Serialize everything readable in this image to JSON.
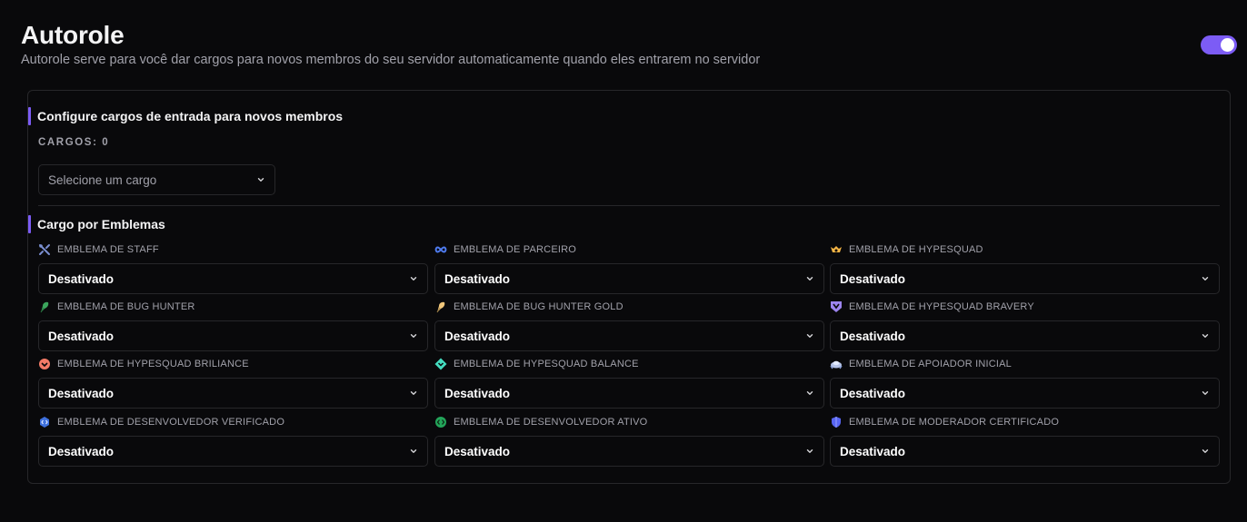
{
  "header": {
    "title": "Autorole",
    "subtitle": "Autorole serve para você dar cargos para novos membros do seu servidor automaticamente quando eles entrarem no servidor",
    "enabled": true
  },
  "entry_roles": {
    "title": "Configure cargos de entrada para novos membros",
    "count_label": "CARGOS: 0",
    "select_placeholder": "Selecione um cargo"
  },
  "badges": {
    "title": "Cargo por Emblemas",
    "items": [
      {
        "label": "EMBLEMA DE STAFF",
        "icon": "staff-icon",
        "value": "Desativado"
      },
      {
        "label": "EMBLEMA DE PARCEIRO",
        "icon": "partner-icon",
        "value": "Desativado"
      },
      {
        "label": "EMBLEMA DE HYPESQUAD",
        "icon": "hypesquad-icon",
        "value": "Desativado"
      },
      {
        "label": "EMBLEMA DE BUG HUNTER",
        "icon": "bug-hunter-icon",
        "value": "Desativado"
      },
      {
        "label": "EMBLEMA DE BUG HUNTER GOLD",
        "icon": "bug-hunter-gold-icon",
        "value": "Desativado"
      },
      {
        "label": "EMBLEMA DE HYPESQUAD BRAVERY",
        "icon": "hypesquad-bravery-icon",
        "value": "Desativado"
      },
      {
        "label": "EMBLEMA DE HYPESQUAD BRILIANCE",
        "icon": "hypesquad-brilliance-icon",
        "value": "Desativado"
      },
      {
        "label": "EMBLEMA DE HYPESQUAD BALANCE",
        "icon": "hypesquad-balance-icon",
        "value": "Desativado"
      },
      {
        "label": "EMBLEMA DE APOIADOR INICIAL",
        "icon": "early-supporter-icon",
        "value": "Desativado"
      },
      {
        "label": "EMBLEMA DE DESENVOLVEDOR VERIFICADO",
        "icon": "verified-developer-icon",
        "value": "Desativado"
      },
      {
        "label": "EMBLEMA DE DESENVOLVEDOR ATIVO",
        "icon": "active-developer-icon",
        "value": "Desativado"
      },
      {
        "label": "EMBLEMA DE MODERADOR CERTIFICADO",
        "icon": "certified-moderator-icon",
        "value": "Desativado"
      }
    ]
  },
  "colors": {
    "accent": "#7c5cf5",
    "background": "#09090b",
    "border": "#27272a"
  }
}
